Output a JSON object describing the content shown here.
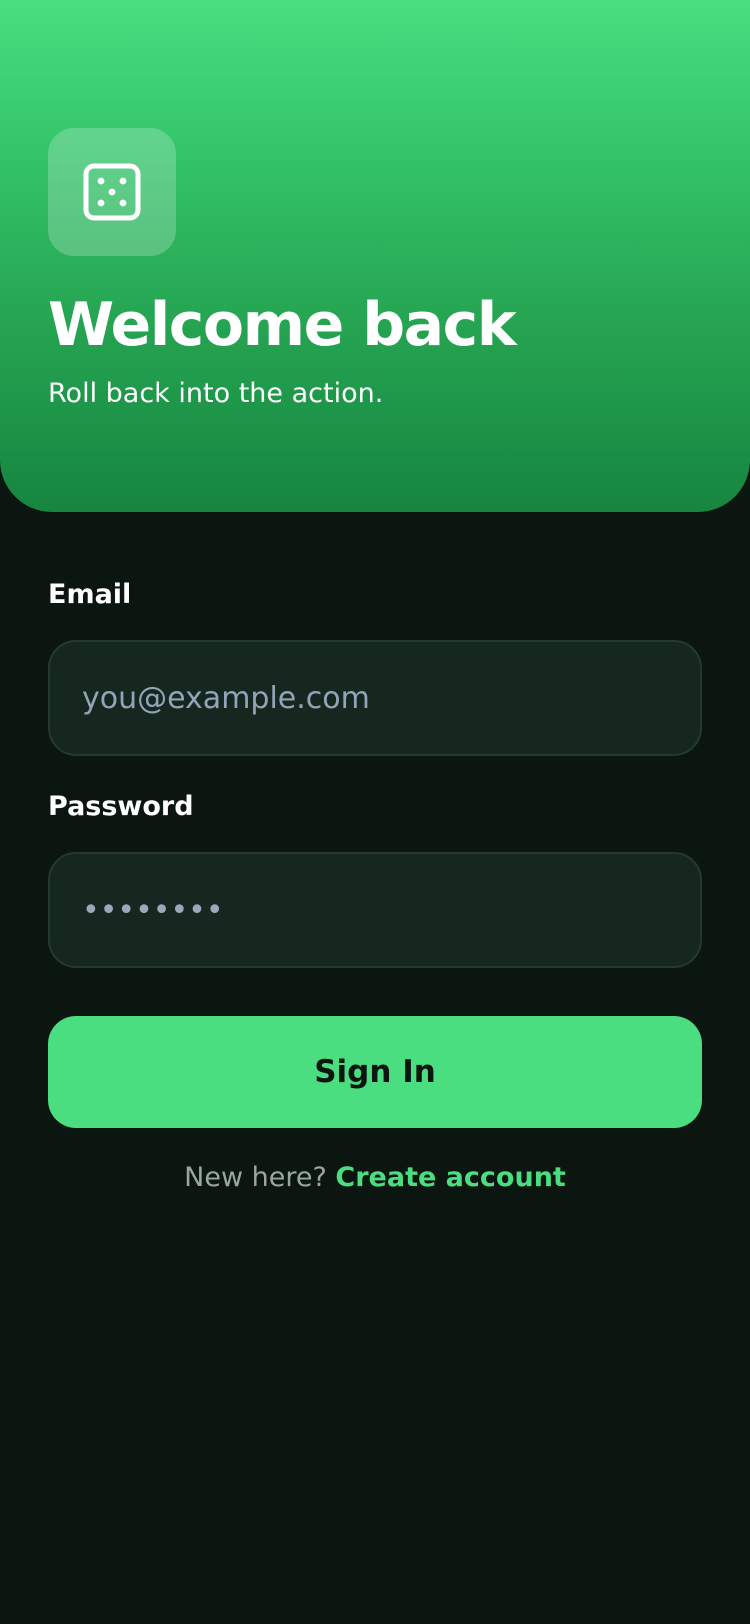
{
  "header": {
    "title": "Welcome back",
    "subtitle": "Roll back into the action.",
    "icon": "dice-icon"
  },
  "form": {
    "email": {
      "label": "Email",
      "value": "",
      "placeholder": "you@example.com"
    },
    "password": {
      "label": "Password",
      "value": "••••••••"
    },
    "submit_label": "Sign In"
  },
  "footer": {
    "prompt": "New here?",
    "link_label": "Create account"
  },
  "colors": {
    "accent": "#4ade80",
    "background": "#0b1610",
    "input_background": "#15271e",
    "header_gradient_top": "#4ade80",
    "header_gradient_bottom": "#168540"
  }
}
